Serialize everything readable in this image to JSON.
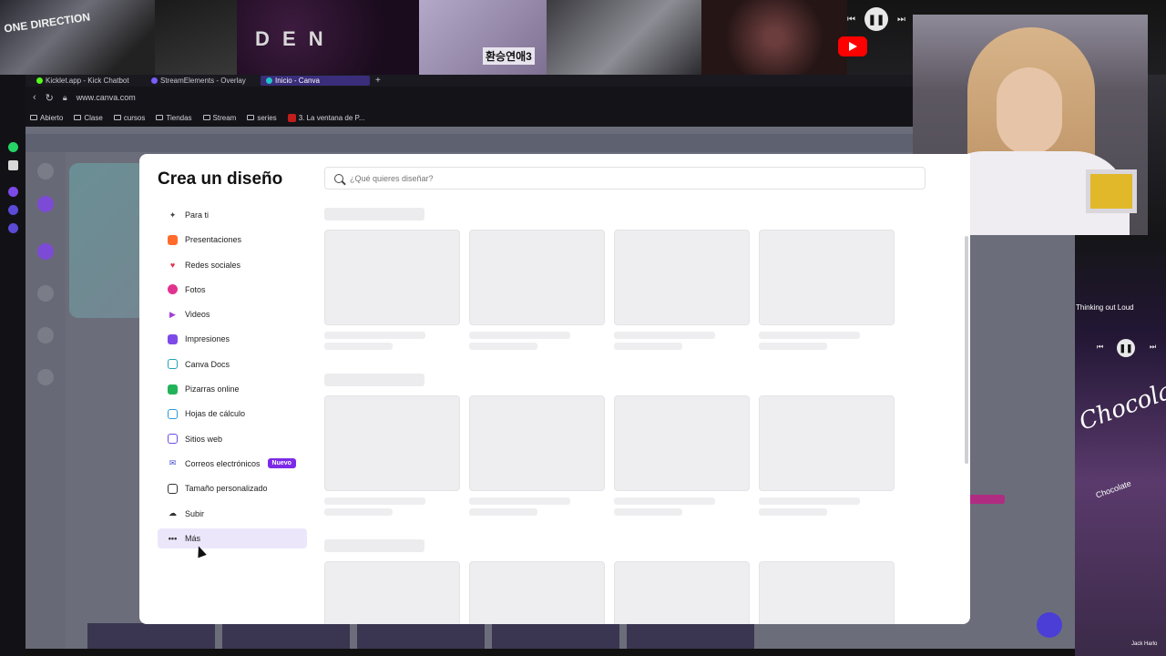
{
  "collage": {
    "tile1_text": "ONE DIRECTION",
    "tile3_text": "D E N",
    "tile4_text": "환승연애3"
  },
  "browser": {
    "tabs": [
      {
        "label": "Kicklet.app - Kick Chatbot"
      },
      {
        "label": "StreamElements - Overlay"
      },
      {
        "label": "Inicio - Canva"
      }
    ],
    "url": "www.canva.com",
    "bookmarks": [
      {
        "label": "Abierto"
      },
      {
        "label": "Clase"
      },
      {
        "label": "cursos"
      },
      {
        "label": "Tiendas"
      },
      {
        "label": "Stream"
      },
      {
        "label": "series"
      },
      {
        "label": "3. La ventana de P..."
      }
    ]
  },
  "modal": {
    "title": "Crea un diseño",
    "search_placeholder": "¿Qué quieres diseñar?",
    "menu": [
      {
        "label": "Para ti",
        "icon": "sparkle-icon",
        "color": "#444444"
      },
      {
        "label": "Presentaciones",
        "icon": "presentation-icon",
        "color": "#ff6b2b"
      },
      {
        "label": "Redes sociales",
        "icon": "heart-icon",
        "color": "#e5334b"
      },
      {
        "label": "Fotos",
        "icon": "camera-icon",
        "color": "#e0338f"
      },
      {
        "label": "Videos",
        "icon": "video-icon",
        "color": "#a23fd6"
      },
      {
        "label": "Impresiones",
        "icon": "print-icon",
        "color": "#7d4ae8"
      },
      {
        "label": "Canva Docs",
        "icon": "doc-icon",
        "color": "#1fa3b5"
      },
      {
        "label": "Pizarras online",
        "icon": "whiteboard-icon",
        "color": "#22b35a"
      },
      {
        "label": "Hojas de cálculo",
        "icon": "sheet-icon",
        "color": "#2a9ad6"
      },
      {
        "label": "Sitios web",
        "icon": "website-icon",
        "color": "#6d4ae8"
      },
      {
        "label": "Correos electrónicos",
        "icon": "mail-icon",
        "color": "#3f4ad6",
        "badge": "Nuevo"
      },
      {
        "label": "Tamaño personalizado",
        "icon": "resize-icon",
        "color": "#333333"
      },
      {
        "label": "Subir",
        "icon": "cloud-upload-icon",
        "color": "#333333"
      },
      {
        "label": "Más",
        "icon": "more-icon",
        "color": "#333333",
        "selected": true
      }
    ]
  },
  "music": {
    "song": "Thinking out Loud",
    "album_text": "Chocolate",
    "album_sub": "Chocolate",
    "credit": "Jack Harlo"
  },
  "colors": {
    "accent": "#7d2ae8",
    "selected_bg": "#ece6fb"
  }
}
